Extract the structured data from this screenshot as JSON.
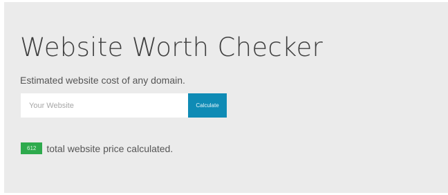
{
  "hero": {
    "title": "Website Worth Checker",
    "subtitle": "Estimated website cost of any domain."
  },
  "form": {
    "input_placeholder": "Your Website",
    "input_value": "",
    "button_label": "Calculate"
  },
  "stats": {
    "count": "612",
    "text": "total website price calculated."
  },
  "colors": {
    "panel_bg": "#ebebeb",
    "button_bg": "#0f8bb5",
    "badge_bg": "#2eaa4d"
  }
}
